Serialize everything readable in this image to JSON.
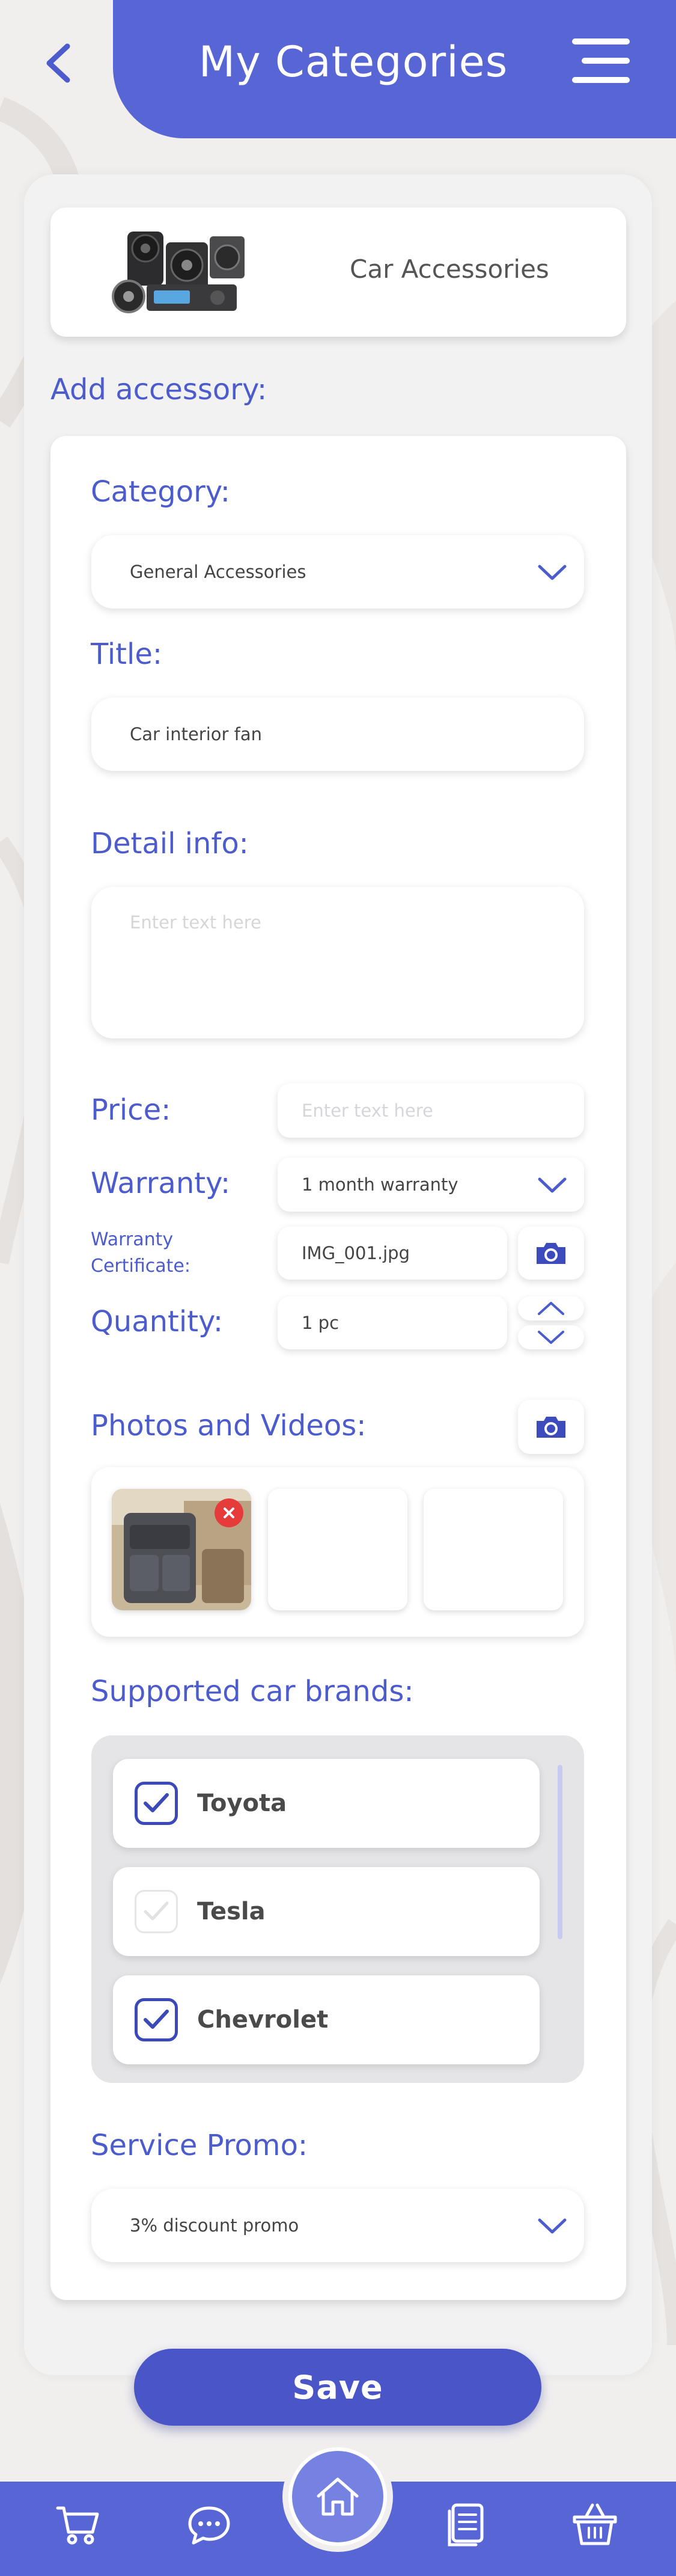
{
  "header": {
    "title": "My Categories",
    "back_icon": "chevron-left-icon",
    "menu_icon": "hamburger-menu-icon"
  },
  "category_card": {
    "name": "Car Accessories",
    "image": "car-audio-speakers-image"
  },
  "form": {
    "section_title": "Add accessory:",
    "category": {
      "label": "Category:",
      "value": "General Accessories"
    },
    "title": {
      "label": "Title:",
      "value": "Car interior fan"
    },
    "detail": {
      "label": "Detail info:",
      "placeholder": "Enter text here"
    },
    "price": {
      "label": "Price:",
      "placeholder": "Enter text here"
    },
    "warranty": {
      "label": "Warranty:",
      "value": "1 month warranty"
    },
    "warranty_cert": {
      "label_line1": "Warranty",
      "label_line2": "Certificate:",
      "value": "IMG_001.jpg"
    },
    "quantity": {
      "label": "Quantity:",
      "value": "1 pc"
    },
    "photos": {
      "label": "Photos and Videos:",
      "thumbnail": "car-seat-organizer-photo"
    },
    "brands": {
      "label": "Supported car brands:",
      "items": [
        {
          "name": "Toyota",
          "checked": true
        },
        {
          "name": "Tesla",
          "checked": false
        },
        {
          "name": "Chevrolet",
          "checked": true
        }
      ]
    },
    "promo": {
      "label": "Service Promo:",
      "value": "3% discount promo"
    }
  },
  "save_label": "Save",
  "bottom_nav": {
    "items": [
      "cart-icon",
      "chat-icon",
      "home-icon",
      "document-icon",
      "basket-icon"
    ]
  },
  "colors": {
    "primary": "#5865d4",
    "label": "#4c5ccd",
    "button": "#4a56c8",
    "delete_badge": "#e63b3b"
  }
}
